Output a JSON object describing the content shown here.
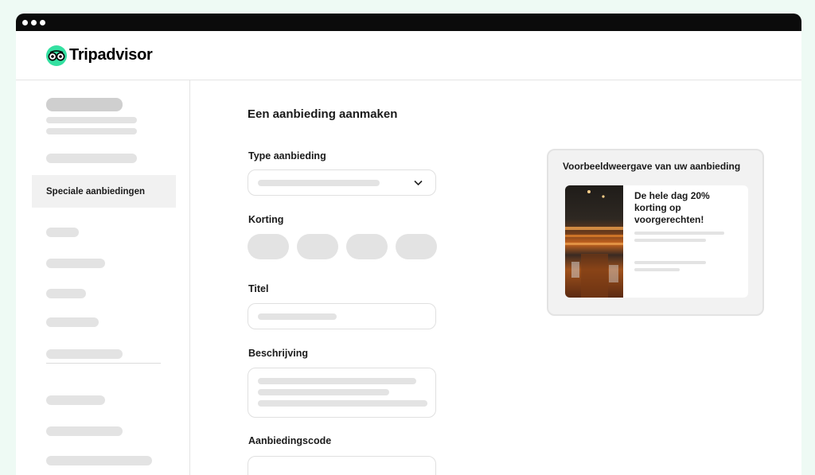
{
  "brand": {
    "name": "Tripadvisor",
    "accent": "#34e0a1"
  },
  "sidebar": {
    "active_item": "Speciale aanbiedingen"
  },
  "form": {
    "heading": "Een aanbieding aanmaken",
    "type_label": "Type aanbieding",
    "discount_label": "Korting",
    "title_label": "Titel",
    "description_label": "Beschrijving",
    "code_label": "Aanbiedingscode"
  },
  "preview": {
    "heading": "Voorbeeldweergave van uw aanbieding",
    "offer_title": "De hele dag 20% korting op voorgerechten!"
  },
  "icons": {
    "dropdown": "chevron-down-icon",
    "logo": "owl-eyes-icon"
  }
}
